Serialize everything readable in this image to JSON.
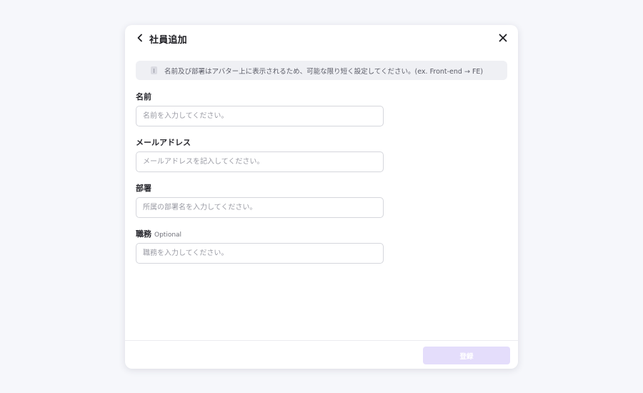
{
  "dialog": {
    "title": "社員追加",
    "back_icon": "chevron-left-icon",
    "close_icon": "close-icon"
  },
  "notice": {
    "icon": "info-icon",
    "text": "名前及び部署はアバター上に表示されるため、可能な限り短く設定してください。(ex. Front-end → FE)"
  },
  "fields": {
    "name": {
      "label": "名前",
      "value": "",
      "placeholder": "名前を入力してください。"
    },
    "email": {
      "label": "メールアドレス",
      "value": "",
      "placeholder": "メールアドレスを記入してください。"
    },
    "department": {
      "label": "部署",
      "value": "",
      "placeholder": "所属の部署名を入力してください。"
    },
    "position": {
      "label": "職務",
      "optional_label": "Optional",
      "value": "",
      "placeholder": "職務を入力してください。"
    }
  },
  "footer": {
    "submit_label": "登録",
    "submit_color": "#e4ddfb",
    "submit_enabled": false
  }
}
